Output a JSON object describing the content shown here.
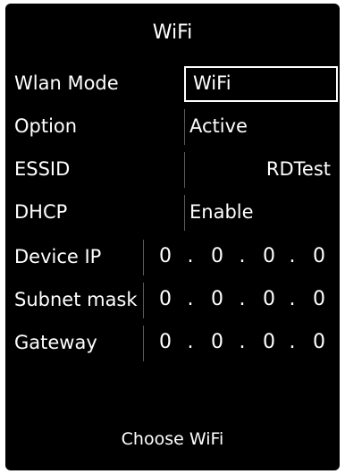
{
  "title": "WiFi",
  "fields": {
    "wlan_mode": {
      "label": "Wlan Mode",
      "value": "WiFi"
    },
    "option": {
      "label": "Option",
      "value": "Active"
    },
    "essid": {
      "label": "ESSID",
      "value": "RDTest"
    },
    "dhcp": {
      "label": "DHCP",
      "value": "Enable"
    },
    "device_ip": {
      "label": "Device IP",
      "octets": [
        "0",
        "0",
        "0",
        "0"
      ]
    },
    "subnet_mask": {
      "label": "Subnet mask",
      "octets": [
        "0",
        "0",
        "0",
        "0"
      ]
    },
    "gateway": {
      "label": "Gateway",
      "octets": [
        "0",
        "0",
        "0",
        "0"
      ]
    }
  },
  "separator": ".",
  "choose_button": "Choose WiFi"
}
